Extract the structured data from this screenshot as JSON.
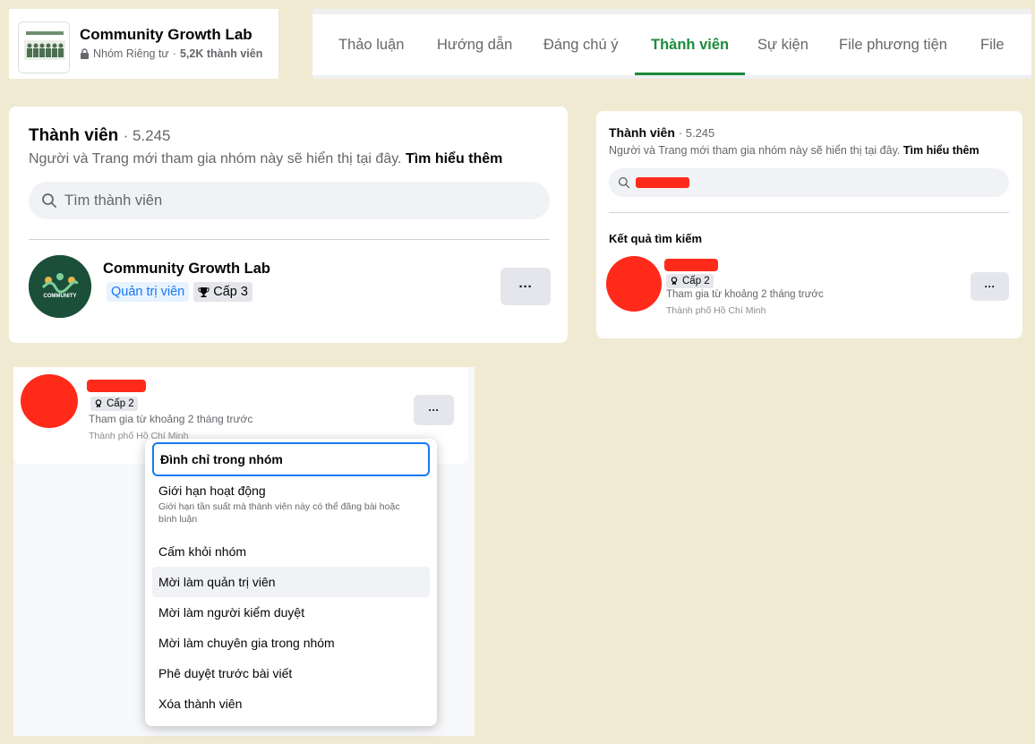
{
  "group": {
    "name": "Community Growth Lab",
    "privacy": "Nhóm Riêng tư",
    "member_count": "5,2K thành viên",
    "separator": "·"
  },
  "tabs": [
    {
      "label": "Thảo luận",
      "active": false
    },
    {
      "label": "Hướng dẫn",
      "active": false
    },
    {
      "label": "Đáng chú ý",
      "active": false
    },
    {
      "label": "Thành viên",
      "active": true
    },
    {
      "label": "Sự kiện",
      "active": false
    },
    {
      "label": "File phương tiện",
      "active": false
    },
    {
      "label": "File",
      "active": false
    }
  ],
  "members": {
    "title": "Thành viên",
    "count": "· 5.245",
    "description": "Người và Trang mới tham gia nhóm này sẽ hiển thị tại đây.",
    "learn_more": "Tìm hiểu thêm",
    "search_placeholder": "Tìm thành viên",
    "admin": {
      "name": "Community Growth Lab",
      "role_badge": "Quản trị viên",
      "level_badge": "Cấp 3",
      "avatar_text": "COMMUNITY"
    },
    "more_label": "···"
  },
  "search_result": {
    "title": "Thành viên",
    "count": "· 5.245",
    "description": "Người và Trang mới tham gia nhóm này sẽ hiển thị tại đây.",
    "learn_more": "Tìm hiểu thêm",
    "results_label": "Kết quả tìm kiếm",
    "member": {
      "level_badge": "Cấp 2",
      "joined": "Tham gia từ khoảng 2 tháng trước",
      "city": "Thành phố Hồ Chí Minh"
    },
    "more_label": "···"
  },
  "menu_card": {
    "member": {
      "level_badge": "Cấp 2",
      "joined": "Tham gia từ khoảng 2 tháng trước",
      "city": "Thành phố Hồ Chí Minh"
    },
    "more_label": "···",
    "menu_items": [
      {
        "label": "Đình chỉ trong nhóm",
        "sub": ""
      },
      {
        "label": "Giới hạn hoạt động",
        "sub": "Giới hạn tần suất mà thành viên này có thể đăng bài hoặc bình luận"
      },
      {
        "label": "Cấm khỏi nhóm",
        "sub": ""
      },
      {
        "label": "Mời làm quản trị viên",
        "sub": ""
      },
      {
        "label": "Mời làm người kiểm duyệt",
        "sub": ""
      },
      {
        "label": "Mời làm chuyên gia trong nhóm",
        "sub": ""
      },
      {
        "label": "Phê duyệt trước bài viết",
        "sub": ""
      },
      {
        "label": "Xóa thành viên",
        "sub": ""
      }
    ]
  },
  "colors": {
    "accent_green": "#1b8a3b",
    "link_blue": "#1877f2",
    "background": "#f1ead3",
    "redaction": "#ff2a1a"
  }
}
